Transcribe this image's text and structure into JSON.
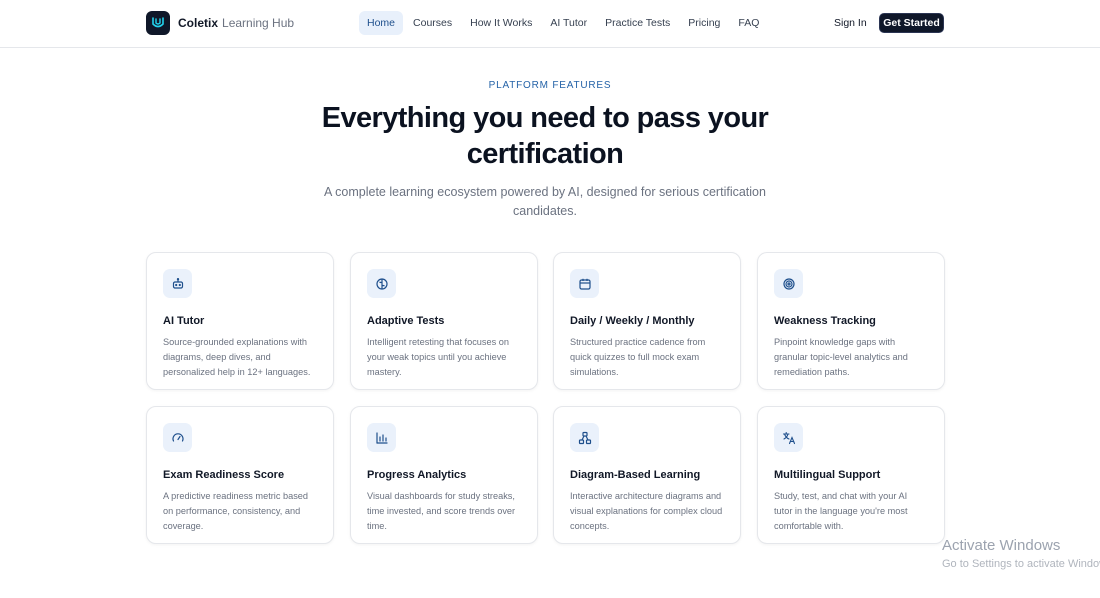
{
  "nav": {
    "brand_name": "Coletix",
    "brand_sub": "Learning Hub",
    "links": [
      {
        "label": "Home"
      },
      {
        "label": "Courses"
      },
      {
        "label": "How It Works"
      },
      {
        "label": "AI Tutor"
      },
      {
        "label": "Practice Tests"
      },
      {
        "label": "Pricing"
      },
      {
        "label": "FAQ"
      }
    ],
    "active_link": "Home",
    "sign_in": "Sign In",
    "cta": "Get Started"
  },
  "hero": {
    "eyebrow": "PLATFORM FEATURES",
    "headline": "Everything you need to pass your certification",
    "subhead": "A complete learning ecosystem powered by AI, designed for serious certification candidates."
  },
  "features": [
    {
      "icon": "bot-icon",
      "title": "AI Tutor",
      "desc": "Source-grounded explanations with diagrams, deep dives, and personalized help in 12+ languages."
    },
    {
      "icon": "brain-icon",
      "title": "Adaptive Tests",
      "desc": "Intelligent retesting that focuses on your weak topics until you achieve mastery."
    },
    {
      "icon": "calendar-icon",
      "title": "Daily / Weekly / Monthly",
      "desc": "Structured practice cadence from quick quizzes to full mock exam simulations."
    },
    {
      "icon": "target-icon",
      "title": "Weakness Tracking",
      "desc": "Pinpoint knowledge gaps with granular topic-level analytics and remediation paths."
    },
    {
      "icon": "gauge-icon",
      "title": "Exam Readiness Score",
      "desc": "A predictive readiness metric based on performance, consistency, and coverage."
    },
    {
      "icon": "bar-chart-icon",
      "title": "Progress Analytics",
      "desc": "Visual dashboards for study streaks, time invested, and score trends over time."
    },
    {
      "icon": "network-icon",
      "title": "Diagram-Based Learning",
      "desc": "Interactive architecture diagrams and visual explanations for complex cloud concepts."
    },
    {
      "icon": "translate-icon",
      "title": "Multilingual Support",
      "desc": "Study, test, and chat with your AI tutor in the language you're most comfortable with."
    }
  ],
  "colors": {
    "accent": "#2563a8",
    "dark": "#0f1729",
    "icon_bg": "#eaf1fb"
  },
  "watermark": {
    "title": "Activate Windows",
    "subtitle": "Go to Settings to activate Windows."
  }
}
